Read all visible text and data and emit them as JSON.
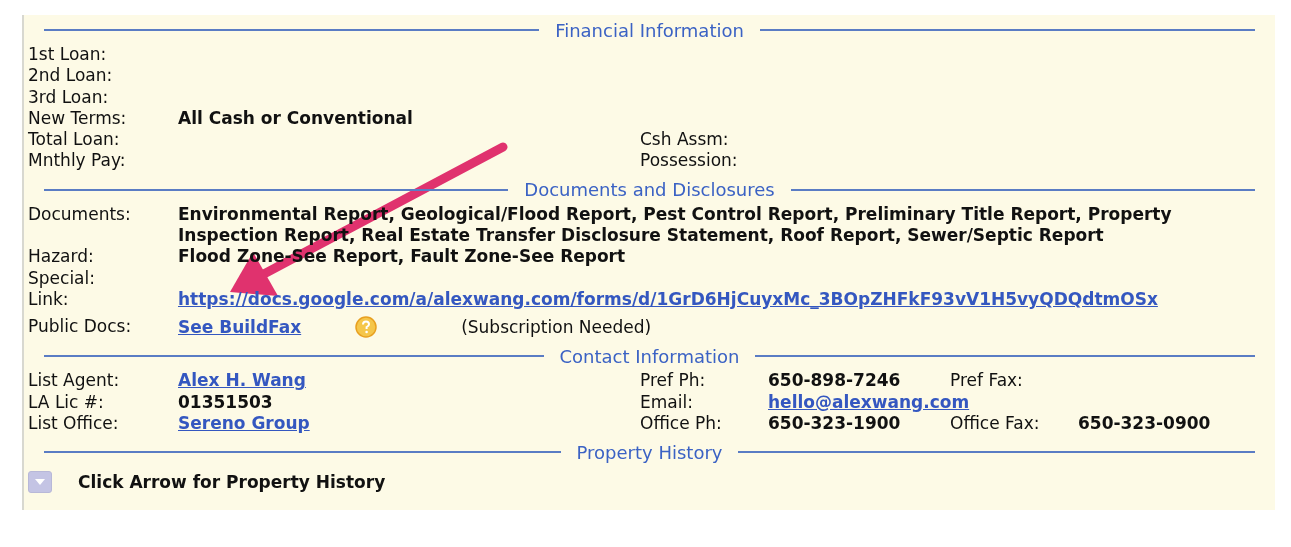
{
  "sections": [
    {
      "title": "Financial Information",
      "rows": [
        {
          "kind": "fields",
          "fields": [
            {
              "label": "1st Loan:"
            }
          ]
        },
        {
          "kind": "fields",
          "fields": [
            {
              "label": "2nd Loan:"
            }
          ]
        },
        {
          "kind": "fields",
          "fields": [
            {
              "label": "3rd Loan:"
            }
          ]
        },
        {
          "kind": "fields",
          "fields": [
            {
              "label": "New Terms:",
              "value": "All Cash or Conventional"
            }
          ]
        },
        {
          "kind": "fields",
          "fields": [
            {
              "label": "Total Loan:"
            },
            {
              "label": "Csh Assm:"
            }
          ]
        },
        {
          "kind": "fields",
          "fields": [
            {
              "label": "Mnthly Pay:"
            },
            {
              "label": "Possession:"
            }
          ]
        }
      ]
    },
    {
      "title": "Documents and Disclosures",
      "rows": [
        {
          "kind": "fields",
          "fields": [
            {
              "label": "Documents:",
              "value": "Environmental Report, Geological/Flood Report, Pest Control Report, Preliminary Title Report, Property Inspection Report, Real Estate Transfer Disclosure Statement, Roof Report, Sewer/Septic Report"
            }
          ]
        },
        {
          "kind": "fields",
          "fields": [
            {
              "label": "Hazard:",
              "value": "Flood Zone-See Report, Fault Zone-See Report"
            }
          ]
        },
        {
          "kind": "fields",
          "fields": [
            {
              "label": "Special:"
            }
          ]
        },
        {
          "kind": "fields",
          "fields": [
            {
              "label": "Link:",
              "link": "https://docs.google.com/a/alexwang.com/forms/d/1GrD6HjCuyxMc_3BOpZHFkF93vV1H5vyQDQdtmOSx"
            }
          ]
        },
        {
          "kind": "help",
          "label": "Public Docs:",
          "link": "See BuildFax",
          "note": "(Subscription Needed)"
        }
      ]
    },
    {
      "title": "Contact Information",
      "rows": [
        {
          "kind": "fields",
          "fields": [
            {
              "label": "List Agent:",
              "link": "Alex H. Wang"
            },
            {
              "label": "Pref Ph:",
              "value": "650-898-7246"
            },
            {
              "label": "Pref Fax:"
            }
          ]
        },
        {
          "kind": "fields",
          "fields": [
            {
              "label": "LA Lic #:",
              "value": "01351503"
            },
            {
              "label": "Email:",
              "link": "hello@alexwang.com"
            }
          ]
        },
        {
          "kind": "fields",
          "fields": [
            {
              "label": "List Office:",
              "link": "Sereno Group"
            },
            {
              "label": "Office Ph:",
              "value": "650-323-1900"
            },
            {
              "label": "Office Fax:",
              "value": "650-323-0900"
            }
          ]
        }
      ]
    },
    {
      "title": "Property History",
      "rows": [
        {
          "kind": "toggle",
          "expanded": false,
          "text": "Click Arrow for Property History"
        }
      ]
    }
  ]
}
